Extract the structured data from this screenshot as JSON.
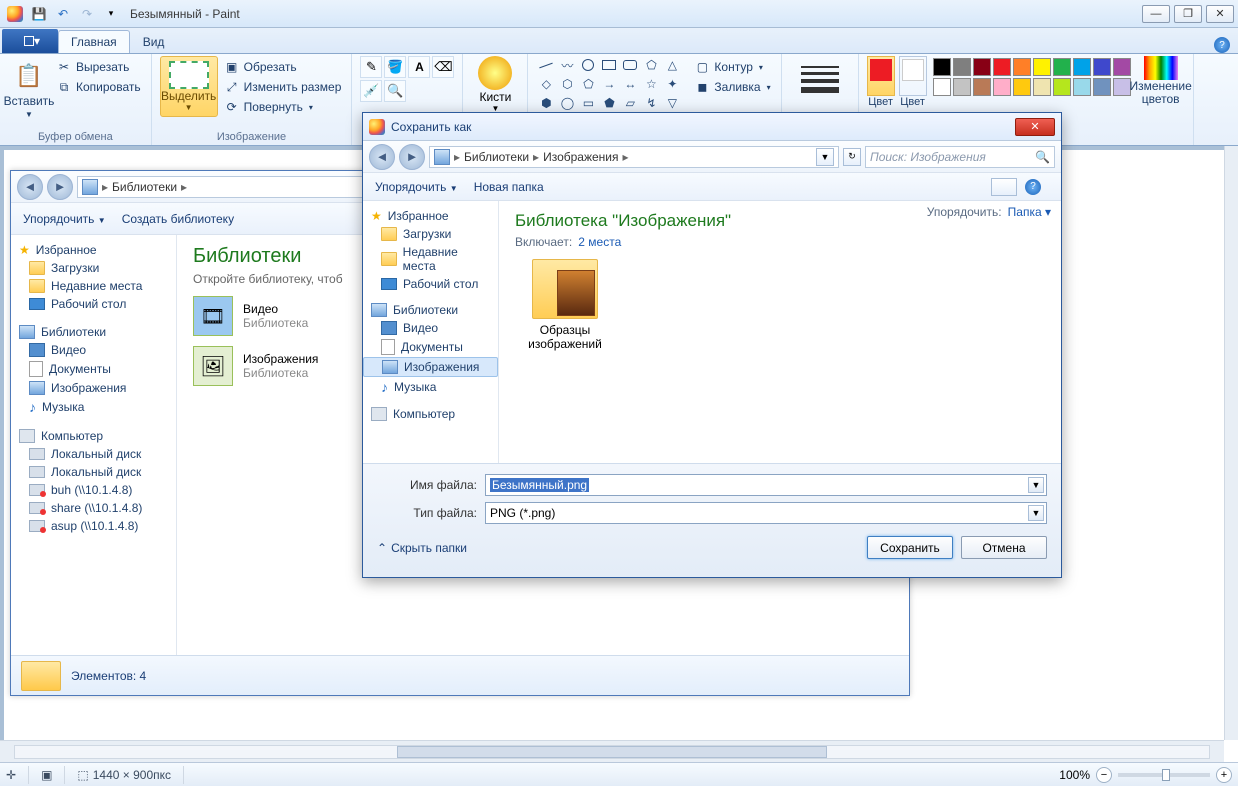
{
  "title": "Безымянный - Paint",
  "tabs": {
    "home": "Главная",
    "view": "Вид"
  },
  "clipboard": {
    "paste": "Вставить",
    "cut": "Вырезать",
    "copy": "Копировать",
    "group": "Буфер обмена"
  },
  "image": {
    "select": "Выделить",
    "crop": "Обрезать",
    "resize": "Изменить размер",
    "rotate": "Повернуть",
    "group": "Изображение"
  },
  "brush": {
    "label": "Кисти"
  },
  "shapes_opts": {
    "outline": "Контур",
    "fill": "Заливка"
  },
  "thickness": "Толщина",
  "color1": "Цвет",
  "color2": "Цвет",
  "edit_colors": "Изменение цветов",
  "palette": [
    "#000000",
    "#7f7f7f",
    "#880015",
    "#ed1c24",
    "#ff7f27",
    "#fff200",
    "#22b14c",
    "#00a2e8",
    "#3f48cc",
    "#a349a4",
    "#ffffff",
    "#c3c3c3",
    "#b97a57",
    "#ffaec9",
    "#ffc90e",
    "#efe4b0",
    "#b5e61d",
    "#99d9ea",
    "#7092be",
    "#c8bfe7"
  ],
  "statusbar": {
    "dims": "1440 × 900пкс",
    "zoom": "100%"
  },
  "explorer_bg": {
    "breadcrumb": "Библиотеки",
    "organize": "Упорядочить",
    "new_lib": "Создать библиотеку",
    "heading": "Библиотеки",
    "subtitle": "Откройте библиотеку, чтоб",
    "footer": "Элементов: 4",
    "fav_group": "Избранное",
    "fav": {
      "downloads": "Загрузки",
      "recent": "Недавние места",
      "desktop": "Рабочий стол"
    },
    "lib_group": "Библиотеки",
    "libs": {
      "video": "Видео",
      "docs": "Документы",
      "images": "Изображения",
      "music": "Музыка"
    },
    "sub_lib": "Библиотека",
    "computer": "Компьютер",
    "drives": {
      "local1": "Локальный диск",
      "local2": "Локальный диск",
      "buh": "buh (\\\\10.1.4.8)",
      "share": "share (\\\\10.1.4.8)",
      "asup": "asup (\\\\10.1.4.8)"
    },
    "content": {
      "video": "Видео",
      "images": "Изображения"
    }
  },
  "dialog": {
    "title": "Сохранить как",
    "breadcrumb": {
      "lib": "Библиотеки",
      "images": "Изображения"
    },
    "search_ph": "Поиск: Изображения",
    "organize": "Упорядочить",
    "new_folder": "Новая папка",
    "heading": "Библиотека \"Изображения\"",
    "includes": "Включает:",
    "includes_link": "2 места",
    "arrange": "Упорядочить:",
    "arrange_val": "Папка",
    "sample_folder": "Образцы изображений",
    "fav_group": "Избранное",
    "fav": {
      "downloads": "Загрузки",
      "recent": "Недавние места",
      "desktop": "Рабочий стол"
    },
    "lib_group": "Библиотеки",
    "libs": {
      "video": "Видео",
      "docs": "Документы",
      "images": "Изображения",
      "music": "Музыка"
    },
    "computer": "Компьютер",
    "filename_label": "Имя файла:",
    "filename_value": "Безымянный.png",
    "filetype_label": "Тип файла:",
    "filetype_value": "PNG (*.png)",
    "hide_folders": "Скрыть папки",
    "save": "Сохранить",
    "cancel": "Отмена"
  }
}
